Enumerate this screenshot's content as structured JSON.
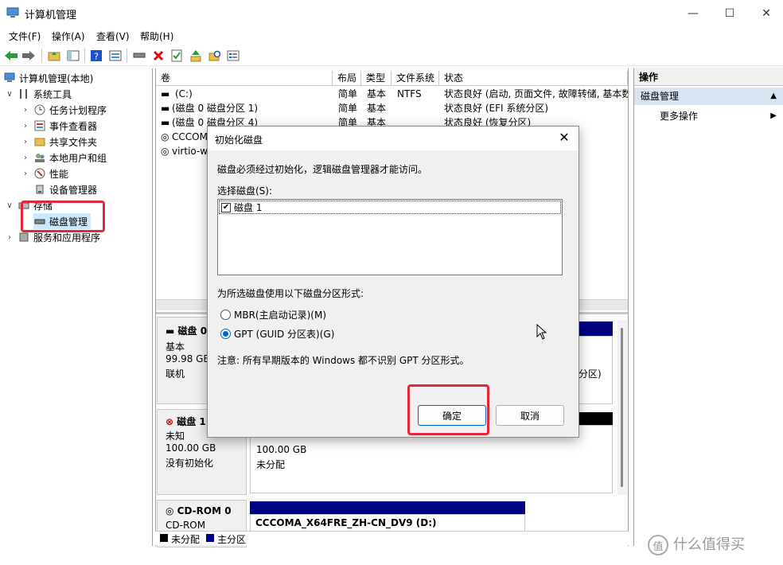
{
  "window": {
    "title": "计算机管理",
    "minimize": "—",
    "maximize": "☐",
    "close": "✕"
  },
  "menu": [
    "文件(F)",
    "操作(A)",
    "查看(V)",
    "帮助(H)"
  ],
  "tree": {
    "root": "计算机管理(本地)",
    "system_tools": "系统工具",
    "task_scheduler": "任务计划程序",
    "event_viewer": "事件查看器",
    "shared_folders": "共享文件夹",
    "local_users": "本地用户和组",
    "performance": "性能",
    "device_manager": "设备管理器",
    "storage": "存储",
    "disk_management": "磁盘管理",
    "services": "服务和应用程序"
  },
  "volumes": {
    "headers": [
      "卷",
      "布局",
      "类型",
      "文件系统",
      "状态"
    ],
    "rows": [
      [
        "(C:)",
        "简单",
        "基本",
        "NTFS",
        "状态良好 (启动, 页面文件, 故障转储, 基本数"
      ],
      [
        "(磁盘 0 磁盘分区 1)",
        "简单",
        "基本",
        "",
        "状态良好 (EFI 系统分区)"
      ],
      [
        "(磁盘 0 磁盘分区 4)",
        "简单",
        "基本",
        "",
        "状态良好 (恢复分区)"
      ],
      [
        "CCCOM",
        "",
        "",
        "",
        ""
      ],
      [
        "virtio-w",
        "",
        "",
        "",
        ""
      ]
    ]
  },
  "disks": {
    "disk0": {
      "name": "磁盘 0",
      "type": "基本",
      "size": "99.98 GB",
      "status": "联机",
      "part_tail": "分区)"
    },
    "disk1": {
      "name": "磁盘 1",
      "type": "未知",
      "size": "100.00 GB",
      "status": "没有初始化",
      "unalloc_size": "100.00 GB",
      "unalloc_label": "未分配"
    },
    "cdrom": {
      "name": "CD-ROM 0",
      "type": "CD-ROM",
      "volume": "CCCOMA_X64FRE_ZH-CN_DV9  (D:)"
    }
  },
  "legend": {
    "unallocated": "未分配",
    "primary": "主分区"
  },
  "actions": {
    "header": "操作",
    "section": "磁盘管理",
    "more": "更多操作"
  },
  "dialog": {
    "title": "初始化磁盘",
    "message": "磁盘必须经过初始化，逻辑磁盘管理器才能访问。",
    "select_label": "选择磁盘(S):",
    "disk_item": "磁盘 1",
    "partition_label": "为所选磁盘使用以下磁盘分区形式:",
    "mbr": "MBR(主启动记录)(M)",
    "gpt": "GPT (GUID 分区表)(G)",
    "note": "注意: 所有早期版本的 Windows 都不识别 GPT 分区形式。",
    "ok": "确定",
    "cancel": "取消"
  },
  "watermark": "什么值得买",
  "colors": {
    "accent": "#0067c0",
    "highlight": "#e0283c",
    "primary_partition": "#000080",
    "selection": "#cce8ff"
  }
}
